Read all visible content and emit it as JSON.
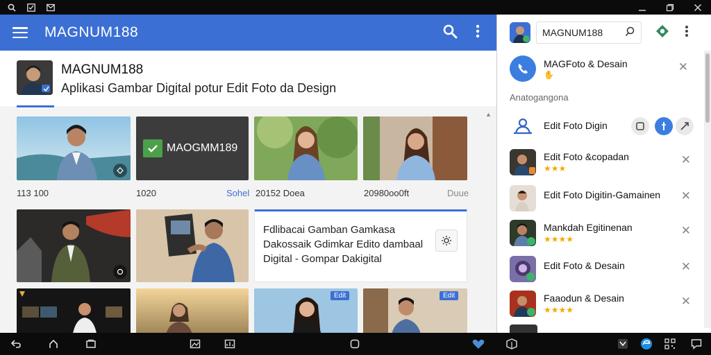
{
  "app": {
    "title": "MAGNUM188"
  },
  "profile": {
    "name": "MAGNUM188",
    "subtitle": "Aplikasi Gambar Digital potur Edit Foto da Design"
  },
  "grid": {
    "captions": {
      "c1": "113 100",
      "c2": "1020",
      "c2_right": "Sohel",
      "c3": "20152 Doea",
      "c4": "20980oo0ft",
      "c4_right": "Duue"
    },
    "brand_tile_text": "MAOGMM189",
    "text_card": "Fdlibacai Gamban Gamkasa Dakossaik Gdimkar Edito dambaal Digital - Gompar Dakigital",
    "badge_1": "Edit",
    "badge_2": "Edit"
  },
  "panel": {
    "search_value": "MAGNUM188",
    "top_item": "MAGFoto & Desain",
    "section_label": "Anatogangona",
    "items": [
      {
        "title": "Edit Foto Digin",
        "stars": ""
      },
      {
        "title": "Edit Foto &copadan",
        "stars": "★★★"
      },
      {
        "title": "Edit Foto Digitin-Gamainen",
        "stars": ""
      },
      {
        "title": "Mankdah Egitinenan",
        "stars": "★★★★"
      },
      {
        "title": "Edit Foto & Desain",
        "stars": ""
      },
      {
        "title": "Faaodun & Desain",
        "stars": "★★★★"
      }
    ]
  },
  "colors": {
    "appbar": "#3b6fd3",
    "accent": "#3b6fd3",
    "star": "#f2a900",
    "system_bar": "#0b0b0b"
  }
}
